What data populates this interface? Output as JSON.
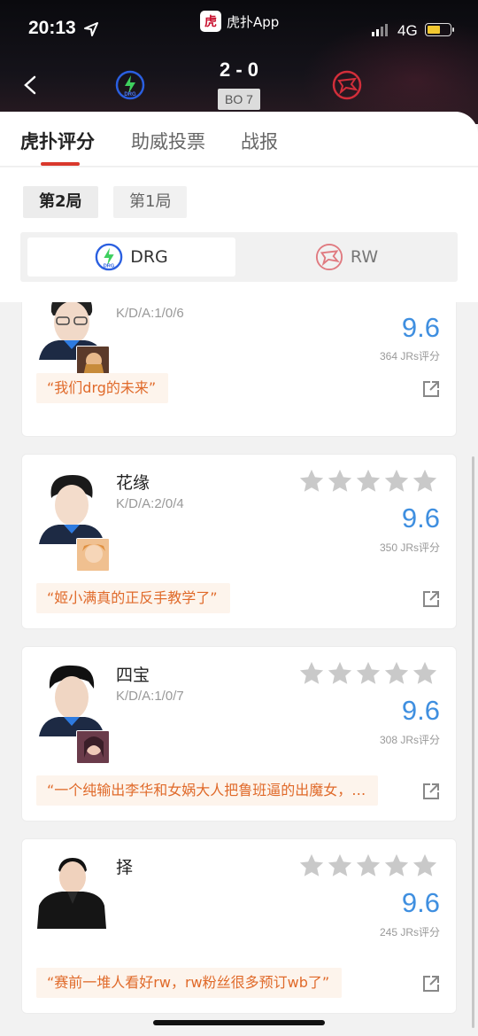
{
  "status_bar": {
    "time": "20:13",
    "network": "4G",
    "app_label": "虎扑App",
    "app_logo_char": "虎"
  },
  "match": {
    "score": "2 - 0",
    "format": "BO 7",
    "team_left": "DRG",
    "team_right": "RW",
    "left_color": "#2a5fe0",
    "right_color": "#d22e3a"
  },
  "tabs": [
    "虎扑评分",
    "助威投票",
    "战报"
  ],
  "rounds": [
    "第2局",
    "第1局"
  ],
  "team_switch": {
    "left": "DRG",
    "right": "RW",
    "left_logo_text": "DRG"
  },
  "players": [
    {
      "name": "",
      "kda": "K/D/A:1/0/6",
      "score": "9.6",
      "votes": "364 JRs评分",
      "comment": "“我们drg的未来”",
      "stars": 5
    },
    {
      "name": "花缘",
      "kda": "K/D/A:2/0/4",
      "score": "9.6",
      "votes": "350 JRs评分",
      "comment": "“姬小满真的正反手教学了”",
      "stars": 5
    },
    {
      "name": "四宝",
      "kda": "K/D/A:1/0/7",
      "score": "9.6",
      "votes": "308 JRs评分",
      "comment": "“一个纯输出李华和女娲大人把鲁班逼的出魔女，…",
      "stars": 5
    },
    {
      "name": "择",
      "kda": "",
      "score": "9.6",
      "votes": "245 JRs评分",
      "comment": "“赛前一堆人看好rw，rw粉丝很多预订wb了”",
      "stars": 5
    }
  ],
  "colors": {
    "accent_red": "#d9382c",
    "score_blue": "#3f8fe0",
    "comment_orange": "#e06a2a",
    "star_grey": "#c9c9c9"
  }
}
